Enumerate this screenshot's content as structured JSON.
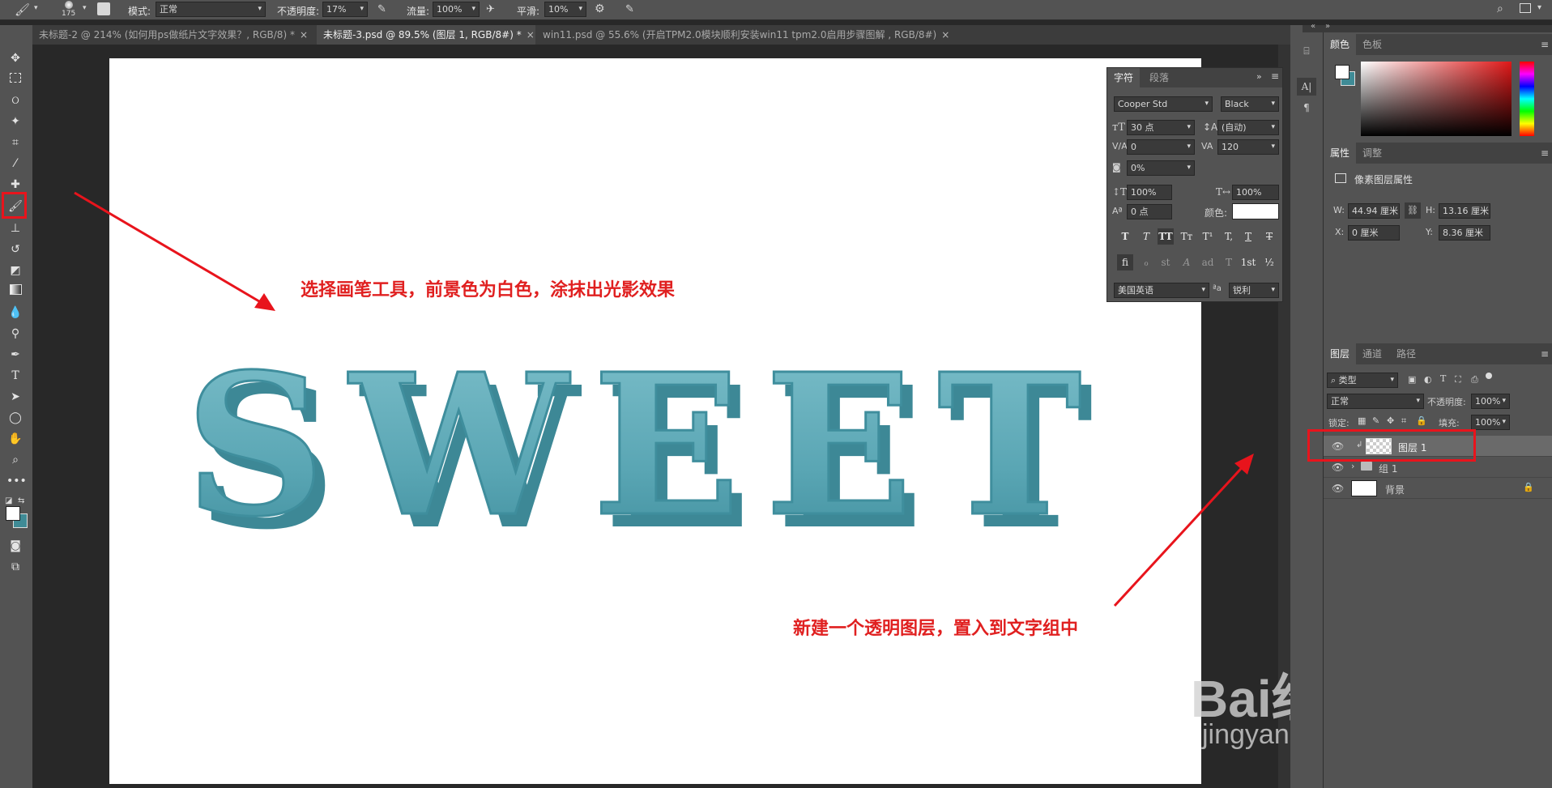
{
  "options_bar": {
    "brush_size": "175",
    "mode_label": "模式:",
    "mode_value": "正常",
    "opacity_label": "不透明度:",
    "opacity_value": "17%",
    "flow_label": "流量:",
    "flow_value": "100%",
    "smoothing_label": "平滑:",
    "smoothing_value": "10%"
  },
  "tabs": [
    {
      "label": "未标题-2 @ 214% (如何用ps做纸片文字效果？, RGB/8) *",
      "close": "×"
    },
    {
      "label": "未标题-3.psd @ 89.5% (图层 1, RGB/8#) *",
      "close": "×"
    },
    {
      "label": "win11.psd @ 55.6% (开启TPM2.0模块顺利安装win11 tpm2.0启用步骤图解 , RGB/8#)",
      "close": "×"
    }
  ],
  "canvas": {
    "artwork_text": "SWEET",
    "artwork_color": "#5aa6b4",
    "annotation_1": "选择画笔工具，前景色为白色，涂抹出光影效果",
    "annotation_2": "新建一个透明图层，置入到文字组中",
    "annotation_color": "#e02020",
    "watermark_brand": "Bai经验",
    "watermark_url": "jingyan.baidu.com"
  },
  "character_panel": {
    "tab_character": "字符",
    "tab_paragraph": "段落",
    "font_family": "Cooper Std",
    "font_style": "Black",
    "font_size": "30 点",
    "leading": "(自动)",
    "kerning": "0",
    "tracking": "120",
    "tsume": "0%",
    "vertical_scale": "100%",
    "horizontal_scale": "100%",
    "baseline_shift": "0 点",
    "color_label": "颜色:",
    "language": "美国英语",
    "aa_label": "ªa",
    "antialias": "锐利",
    "style_buttons": [
      "T",
      "T",
      "TT",
      "Tт",
      "T¹",
      "T,",
      "T",
      "T"
    ],
    "opentype_buttons": [
      "fi",
      "ℴ",
      "st",
      "A",
      "ad",
      "T",
      "1st",
      "½"
    ]
  },
  "color_panel": {
    "tab_color": "颜色",
    "tab_swatches": "色板"
  },
  "properties_panel": {
    "tab_properties": "属性",
    "tab_adjustments": "调整",
    "title": "像素图层属性",
    "w_label": "W:",
    "w_value": "44.94 厘米",
    "h_label": "H:",
    "h_value": "13.16 厘米",
    "x_label": "X:",
    "x_value": "0 厘米",
    "y_label": "Y:",
    "y_value": "8.36 厘米"
  },
  "layers_panel": {
    "tab_layers": "图层",
    "tab_channels": "通道",
    "tab_paths": "路径",
    "filter_kind": "类型",
    "blend_mode": "正常",
    "opacity_label": "不透明度:",
    "opacity_value": "100%",
    "lock_label": "锁定:",
    "fill_label": "填充:",
    "fill_value": "100%",
    "layers": [
      {
        "name": "图层 1",
        "type": "pixel",
        "selected": true
      },
      {
        "name": "组 1",
        "type": "group",
        "selected": false
      },
      {
        "name": "背景",
        "type": "background",
        "selected": false
      }
    ]
  }
}
